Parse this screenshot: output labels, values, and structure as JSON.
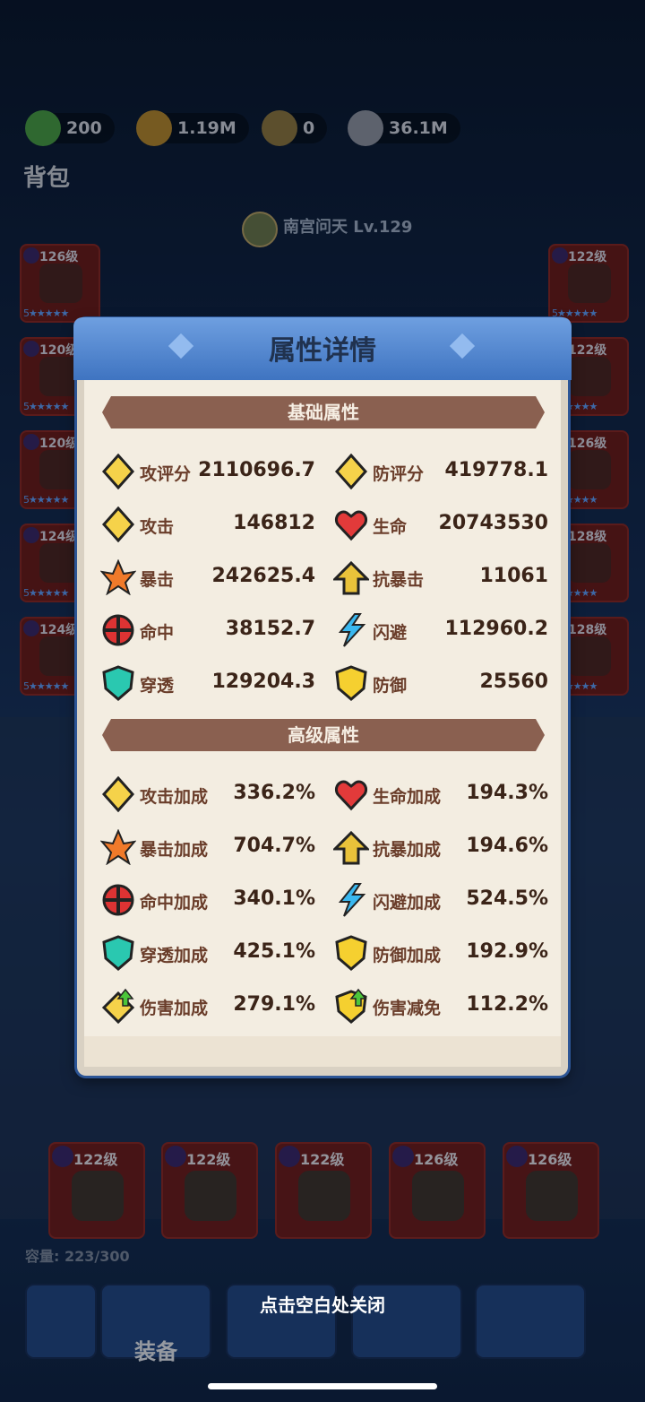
{
  "currencies": [
    {
      "value": "200",
      "icon": "green-gem-icon",
      "color": "#49a04a"
    },
    {
      "value": "1.19M",
      "icon": "gold-coin-icon",
      "color": "#b58a34"
    },
    {
      "value": "0",
      "icon": "bound-coin-icon",
      "color": "#8e7a45"
    },
    {
      "value": "36.1M",
      "icon": "silver-coin-icon",
      "color": "#8f97a8"
    }
  ],
  "bag_title": "背包",
  "hero": {
    "name": "南宫问天 Lv.129"
  },
  "left_slots": [
    {
      "level": "126级",
      "stars": "5★★★★★"
    },
    {
      "level": "120级",
      "stars": "5★★★★★"
    },
    {
      "level": "120级",
      "stars": "5★★★★★"
    },
    {
      "level": "124级",
      "stars": "5★★★★★"
    },
    {
      "level": "124级",
      "stars": "5★★★★★"
    }
  ],
  "right_slots": [
    {
      "level": "122级",
      "stars": "5★★★★★"
    },
    {
      "level": "122级",
      "stars": "5★★★★★"
    },
    {
      "level": "126级",
      "stars": "5★★★★★"
    },
    {
      "level": "128级",
      "stars": "5★★★★★"
    },
    {
      "level": "128级",
      "stars": "5★★★★★"
    }
  ],
  "bag_items_bottom": [
    {
      "level": "122级"
    },
    {
      "level": "122级"
    },
    {
      "level": "122级"
    },
    {
      "level": "126级"
    },
    {
      "level": "126级"
    }
  ],
  "capacity": "容量: 223/300",
  "nav": {
    "equip_label": "装备"
  },
  "close_hint": "点击空白处关闭",
  "modal": {
    "title": "属性详情",
    "basic_title": "基础属性",
    "advanced_title": "高级属性",
    "basic": [
      {
        "label": "攻评分",
        "value": "2110696.7",
        "icon": "attack-rating-icon"
      },
      {
        "label": "防评分",
        "value": "419778.1",
        "icon": "defense-rating-icon"
      },
      {
        "label": "攻击",
        "value": "146812",
        "icon": "attack-icon"
      },
      {
        "label": "生命",
        "value": "20743530",
        "icon": "heart-icon"
      },
      {
        "label": "暴击",
        "value": "242625.4",
        "icon": "crit-icon"
      },
      {
        "label": "抗暴击",
        "value": "11061",
        "icon": "crit-resist-icon"
      },
      {
        "label": "命中",
        "value": "38152.7",
        "icon": "hit-icon"
      },
      {
        "label": "闪避",
        "value": "112960.2",
        "icon": "dodge-icon"
      },
      {
        "label": "穿透",
        "value": "129204.3",
        "icon": "penetration-icon"
      },
      {
        "label": "防御",
        "value": "25560",
        "icon": "defense-icon"
      }
    ],
    "advanced": [
      {
        "label": "攻击加成",
        "value": "336.2%",
        "icon": "attack-bonus-icon"
      },
      {
        "label": "生命加成",
        "value": "194.3%",
        "icon": "hp-bonus-icon"
      },
      {
        "label": "暴击加成",
        "value": "704.7%",
        "icon": "crit-bonus-icon"
      },
      {
        "label": "抗暴加成",
        "value": "194.6%",
        "icon": "crit-resist-bonus-icon"
      },
      {
        "label": "命中加成",
        "value": "340.1%",
        "icon": "hit-bonus-icon"
      },
      {
        "label": "闪避加成",
        "value": "524.5%",
        "icon": "dodge-bonus-icon"
      },
      {
        "label": "穿透加成",
        "value": "425.1%",
        "icon": "penetration-bonus-icon"
      },
      {
        "label": "防御加成",
        "value": "192.9%",
        "icon": "defense-bonus-icon"
      },
      {
        "label": "伤害加成",
        "value": "279.1%",
        "icon": "damage-bonus-icon"
      },
      {
        "label": "伤害减免",
        "value": "112.2%",
        "icon": "damage-reduction-icon"
      }
    ]
  }
}
